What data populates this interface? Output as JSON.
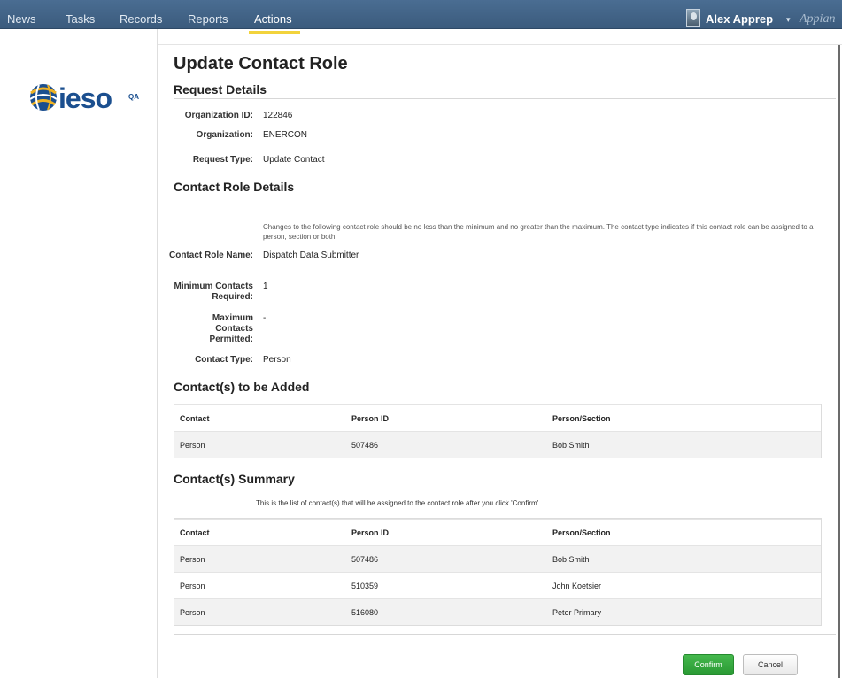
{
  "nav": {
    "tabs": [
      {
        "label": "News"
      },
      {
        "label": "Tasks"
      },
      {
        "label": "Records"
      },
      {
        "label": "Reports"
      },
      {
        "label": "Actions"
      }
    ],
    "active_tab": "Actions",
    "user_name": "Alex Apprep",
    "user_caret": "▾",
    "brand": "Appian"
  },
  "logo": {
    "word": "ieso",
    "badge": "QA"
  },
  "page": {
    "title": "Update Contact Role"
  },
  "request_details": {
    "heading": "Request Details",
    "fields": [
      {
        "label": "Organization ID:",
        "value": "122846"
      },
      {
        "label": "Organization:",
        "value": "ENERCON"
      },
      {
        "label": "Request Type:",
        "value": "Update Contact"
      }
    ]
  },
  "contact_role_details": {
    "heading": "Contact Role Details",
    "instructions": "Changes to the following contact role should be no less than the minimum and no greater than the maximum. The contact type indicates if this contact role can be assigned to a person, section or both.",
    "fields": [
      {
        "label": "Contact Role Name:",
        "value": "Dispatch Data Submitter"
      },
      {
        "label": "Minimum Contacts Required:",
        "value": "1"
      },
      {
        "label": "Maximum Contacts Permitted:",
        "value": "-"
      },
      {
        "label": "Contact Type:",
        "value": "Person"
      }
    ]
  },
  "contacts_added": {
    "heading": "Contact(s) to be Added",
    "columns": [
      "Contact",
      "Person ID",
      "Person/Section"
    ],
    "rows": [
      [
        "Person",
        "507486",
        "Bob Smith"
      ]
    ]
  },
  "contacts_summary": {
    "heading": "Contact(s) Summary",
    "note": "This is the list of contact(s) that will be assigned to the contact role after you click 'Confirm'.",
    "columns": [
      "Contact",
      "Person ID",
      "Person/Section"
    ],
    "rows": [
      [
        "Person",
        "507486",
        "Bob Smith"
      ],
      [
        "Person",
        "510359",
        "John Koetsier"
      ],
      [
        "Person",
        "516080",
        "Peter Primary"
      ]
    ]
  },
  "buttons": {
    "confirm": "Confirm",
    "cancel": "Cancel"
  },
  "colors": {
    "nav_bg": "#3f6186",
    "active_underline": "#f2d33c",
    "confirm_green": "#2e9f37",
    "logo_blue": "#1b4f8f",
    "logo_gold": "#f0b323"
  }
}
